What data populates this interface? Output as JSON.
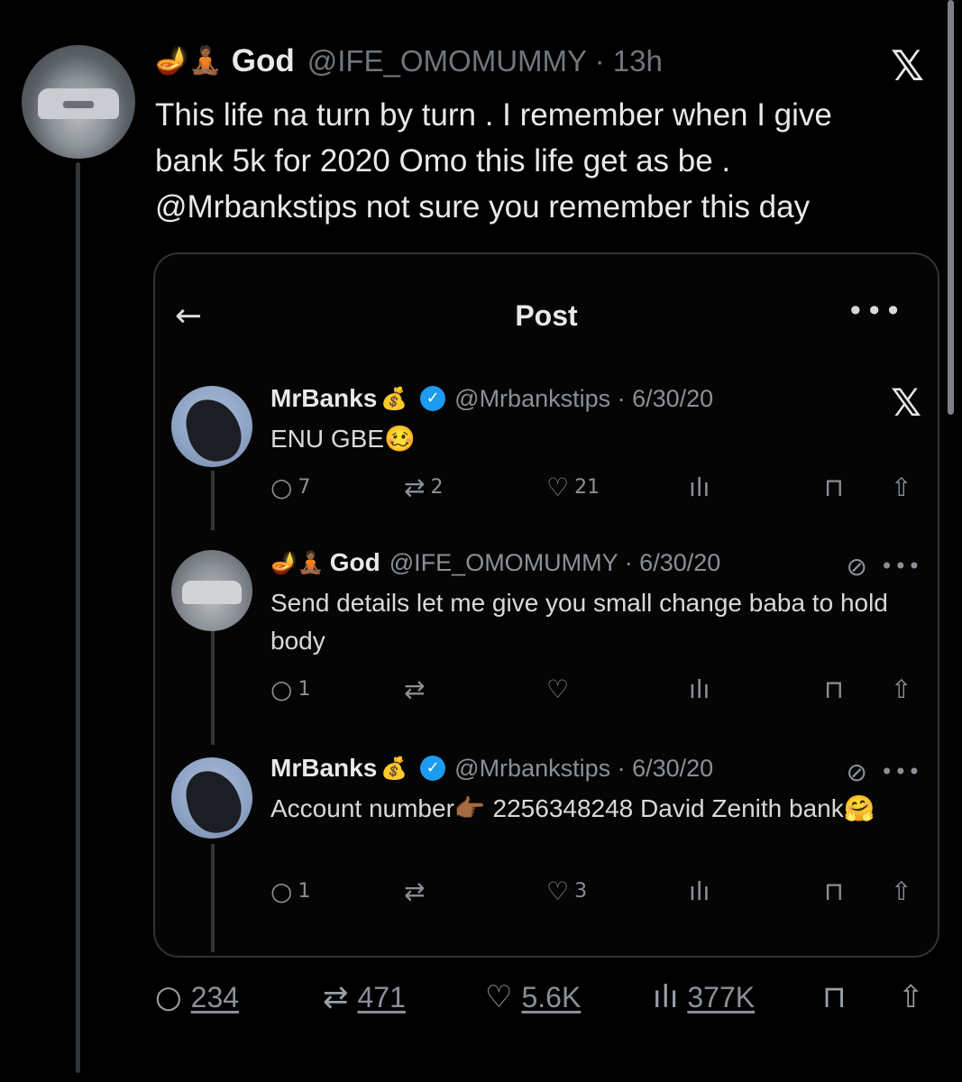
{
  "tweet": {
    "emoji": "🪔🧘🏾",
    "display_name": "God",
    "handle": "@IFE_OMOMUMMY",
    "separator": "·",
    "time": "13h",
    "platform_logo": "𝕏",
    "text_lines": [
      "This life na turn by turn . I remember when I give",
      "bank 5k for 2020 Omo this life get as be .",
      "@Mrbankstips not sure you remember this  day"
    ],
    "stats": {
      "replies": "234",
      "retweets": "471",
      "likes": "5.6K",
      "views": "377K"
    }
  },
  "quote": {
    "title": "Post",
    "back_icon": "←",
    "more_icon": "•••",
    "replies": [
      {
        "name": "MrBanks",
        "name_emoji": "💰",
        "verified": true,
        "handle": "@Mrbankstips · 6/30/20",
        "text": "ENU GBE🥴",
        "reply_count": "7",
        "retweet_count": "2",
        "like_count": "21"
      },
      {
        "name": "God",
        "name_emoji": "🪔🧘🏾",
        "verified": false,
        "handle": "@IFE_OMOMUMMY · 6/30/20",
        "text": "Send details let me give you small change baba to hold body",
        "reply_count": "1",
        "retweet_count": "",
        "like_count": ""
      },
      {
        "name": "MrBanks",
        "name_emoji": "💰",
        "verified": true,
        "handle": "@Mrbankstips · 6/30/20",
        "text": "Account number👉🏾 2256348248 David Zenith bank🤗",
        "reply_count": "1",
        "retweet_count": "",
        "like_count": "3"
      }
    ]
  },
  "icons": {
    "reply": "reply-icon",
    "retweet": "retweet-icon",
    "like": "heart-icon",
    "views": "views-icon",
    "bookmark": "bookmark-icon",
    "share": "share-icon"
  },
  "colors": {
    "background": "#000000",
    "text": "#e7e9ea",
    "muted": "#71767b",
    "verified": "#1d9bf0"
  }
}
